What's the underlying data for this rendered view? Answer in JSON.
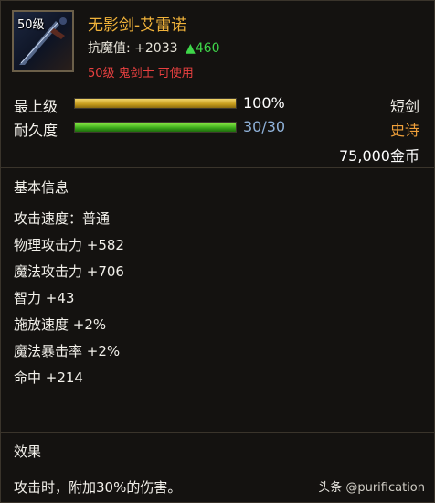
{
  "item": {
    "level_badge": "50级",
    "name": "无影剑-艾雷诺",
    "resist_label": "抗魔值:",
    "resist_value": "+2033",
    "resist_increase": "▲460",
    "requirement": "50级 鬼剑士 可使用"
  },
  "bars": {
    "upgrade": {
      "label": "最上级",
      "value_text": "100%",
      "fill_fraction": 1.0,
      "right_text": "短剑"
    },
    "durability": {
      "label": "耐久度",
      "value_text": "30/30",
      "fill_fraction": 1.0,
      "right_text": "史诗"
    }
  },
  "price": "75,000金币",
  "basic_info": {
    "title": "基本信息",
    "stats": [
      "攻击速度：普通",
      "物理攻击力 +582",
      "魔法攻击力 +706",
      "智力 +43",
      "施放速度 +2%",
      "魔法暴击率 +2%",
      "命中 +214"
    ]
  },
  "effect": {
    "title": "效果",
    "text": "攻击时，附加30%的伤害。"
  },
  "watermark": {
    "prefix": "头条",
    "handle": "@purification"
  },
  "colors": {
    "item_name": "#f0b23a",
    "requirement": "#e84040",
    "increase": "#3fd64a",
    "epic": "#f0a03a"
  },
  "icons": {
    "item_icon": "sword-icon"
  }
}
